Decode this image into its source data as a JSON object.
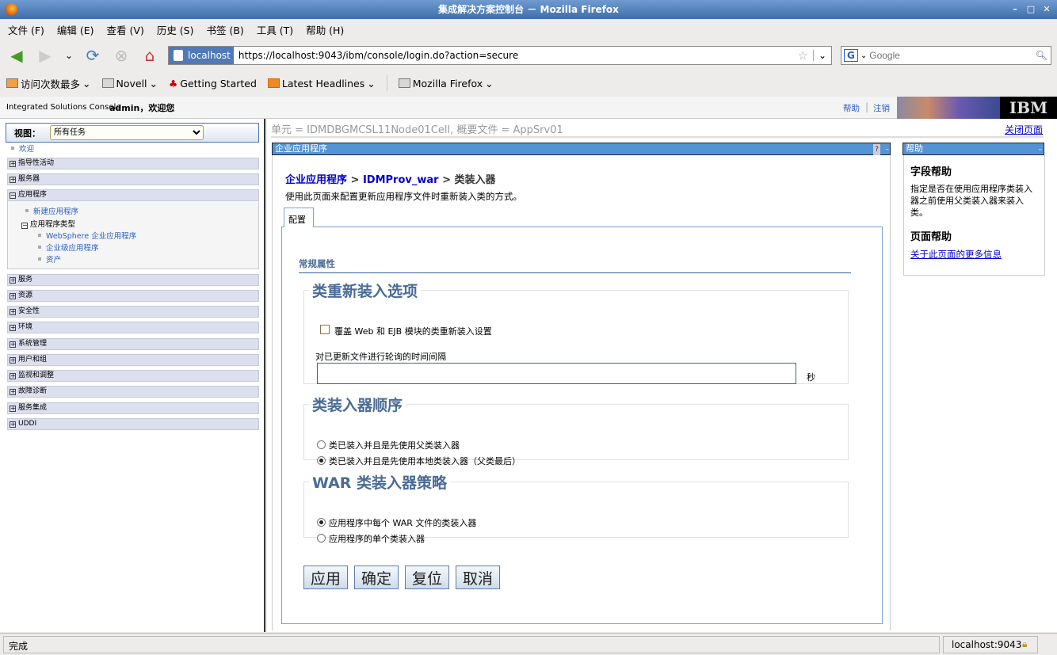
{
  "window": {
    "title": "集成解决方案控制台 － Mozilla Firefox"
  },
  "menu": [
    "文件 (F)",
    "编辑 (E)",
    "查看 (V)",
    "历史 (S)",
    "书签 (B)",
    "工具 (T)",
    "帮助 (H)"
  ],
  "urlbar": {
    "site": "localhost",
    "url": "https://localhost:9043/ibm/console/login.do?action=secure"
  },
  "search": {
    "placeholder": "Google"
  },
  "bookmarks": [
    "访问次数最多",
    "Novell",
    "Getting Started",
    "Latest Headlines",
    "Mozilla Firefox"
  ],
  "console": {
    "product": "Integrated Solutions Console",
    "welcome": "admin，欢迎您",
    "help": "帮助",
    "logout": "注销",
    "logo": "IBM"
  },
  "leftnav": {
    "view_label": "视图：",
    "view_value": "所有任务",
    "welcome": "欢迎",
    "sections_top": [
      "指导性活动",
      "服务器"
    ],
    "applications": "应用程序",
    "new_app": "新建应用程序",
    "app_types": "应用程序类型",
    "app_type_items": [
      "WebSphere 企业应用程序",
      "企业级应用程序",
      "资产"
    ],
    "sections_bottom": [
      "服务",
      "资源",
      "安全性",
      "环境",
      "系统管理",
      "用户和组",
      "监视和调整",
      "故障诊断",
      "服务集成",
      "UDDI"
    ]
  },
  "main": {
    "scope": "单元 = IDMDBGMCSL11Node01Cell, 概要文件 = AppSrv01",
    "close_page": "关闭页面",
    "portlet_title": "企业应用程序",
    "breadcrumb": {
      "l1": "企业应用程序",
      "l2": "IDMProv_war",
      "current": "类装入器"
    },
    "description": "使用此页面来配置更新应用程序文件时重新装入类的方式。",
    "tab": "配置",
    "general_props": "常规属性",
    "reload": {
      "legend": "类重新装入选项",
      "override_label": "覆盖 Web 和 EJB 模块的类重新装入设置",
      "override_checked": false,
      "interval_label": "对已更新文件进行轮询的时间间隔",
      "interval_value": "",
      "unit": "秒"
    },
    "order": {
      "legend": "类装入器顺序",
      "options": [
        "类已装入并且是先使用父类装入器",
        "类已装入并且是先使用本地类装入器（父类最后）"
      ],
      "selected": 1
    },
    "war": {
      "legend": "WAR 类装入器策略",
      "options": [
        "应用程序中每个 WAR 文件的类装入器",
        "应用程序的单个类装入器"
      ],
      "selected": 0
    },
    "buttons": {
      "apply": "应用",
      "ok": "确定",
      "reset": "复位",
      "cancel": "取消"
    }
  },
  "help": {
    "title": "帮助",
    "field_help": "字段帮助",
    "field_text": "指定是否在使用应用程序类装入器之前使用父类装入器来装入类。",
    "page_help": "页面帮助",
    "more_info": "关于此页面的更多信息"
  },
  "status": {
    "text": "完成",
    "host": "localhost:9043"
  }
}
